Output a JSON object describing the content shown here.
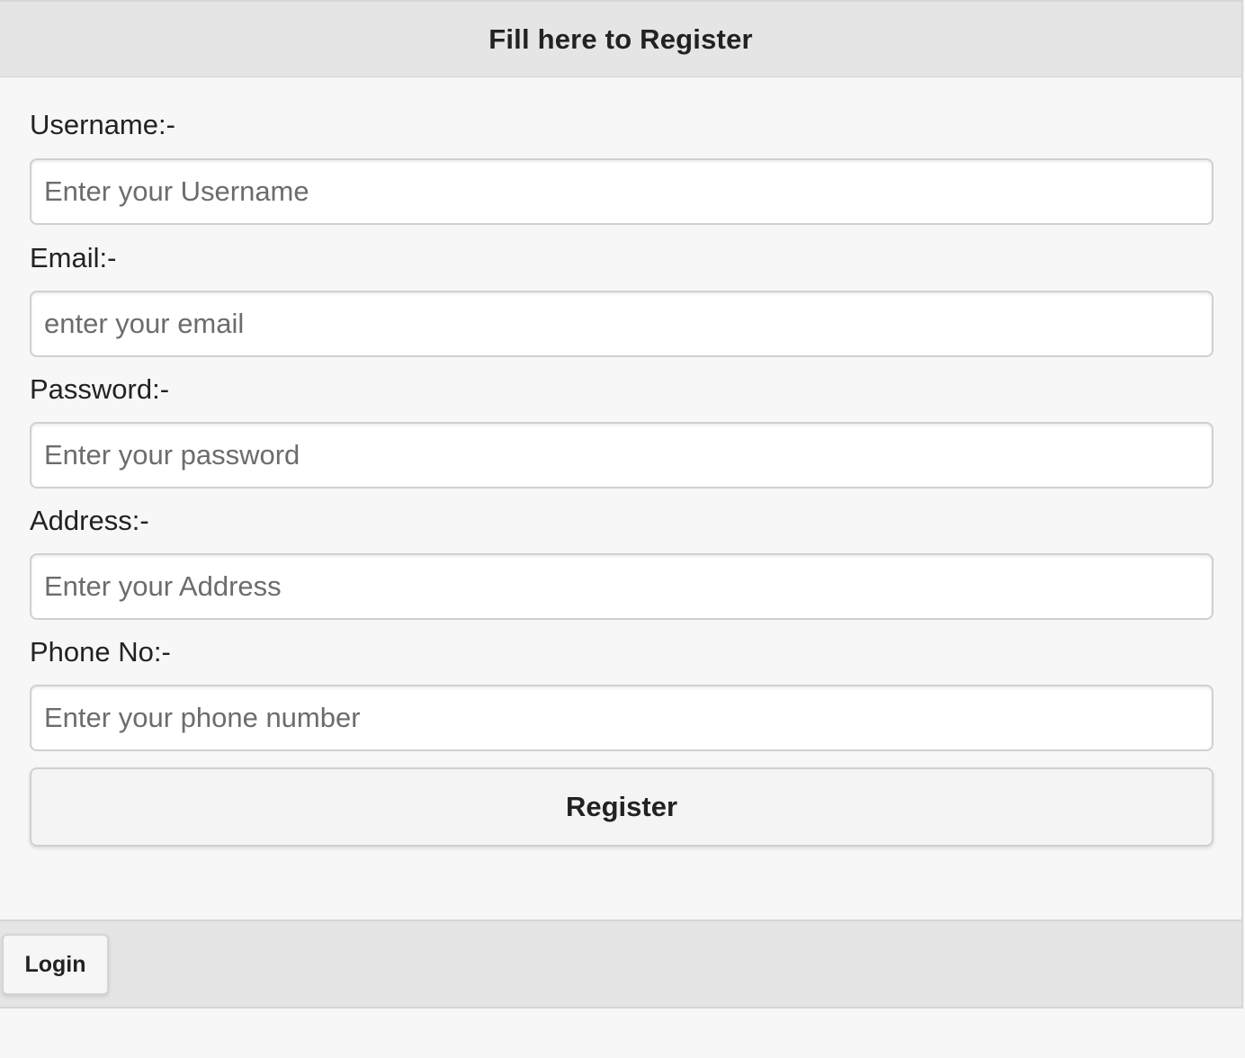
{
  "header": {
    "title": "Fill here to Register"
  },
  "form": {
    "fields": [
      {
        "label": "Username:-",
        "placeholder": "Enter your Username",
        "value": ""
      },
      {
        "label": "Email:-",
        "placeholder": "enter your email",
        "value": ""
      },
      {
        "label": "Password:-",
        "placeholder": "Enter your password",
        "value": ""
      },
      {
        "label": "Address:-",
        "placeholder": "Enter your Address",
        "value": ""
      },
      {
        "label": "Phone No:-",
        "placeholder": "Enter your phone number",
        "value": ""
      }
    ],
    "submit_label": "Register"
  },
  "footer": {
    "login_label": "Login"
  },
  "colors": {
    "bar_background": "#e5e5e5",
    "page_background": "#f7f7f7",
    "input_background": "#ffffff",
    "border": "#d0d0d0",
    "text": "#222222",
    "placeholder": "#6c6c6c"
  }
}
